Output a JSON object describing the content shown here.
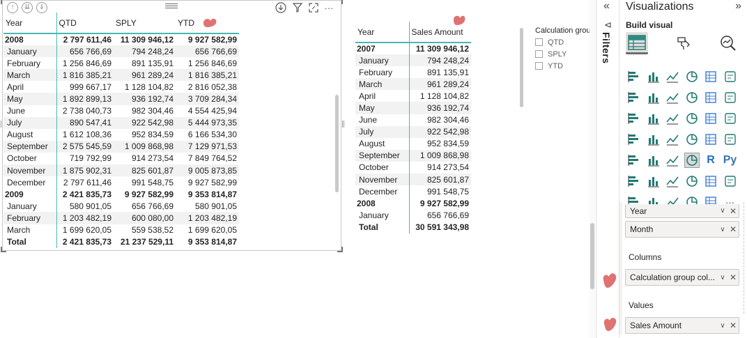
{
  "visual1": {
    "headers": [
      "Year",
      "QTD",
      "SPLY",
      "YTD"
    ],
    "rows": [
      {
        "kind": "year",
        "label": "2008",
        "qtd": "2 797 611,46",
        "sply": "11 309 946,12",
        "ytd": "9 927 582,99"
      },
      {
        "kind": "month",
        "label": "January",
        "qtd": "656 766,69",
        "sply": "794 248,24",
        "ytd": "656 766,69"
      },
      {
        "kind": "month",
        "label": "February",
        "qtd": "1 256 846,69",
        "sply": "891 135,91",
        "ytd": "1 256 846,69"
      },
      {
        "kind": "month",
        "label": "March",
        "qtd": "1 816 385,21",
        "sply": "961 289,24",
        "ytd": "1 816 385,21"
      },
      {
        "kind": "month",
        "label": "April",
        "qtd": "999 667,17",
        "sply": "1 128 104,82",
        "ytd": "2 816 052,38"
      },
      {
        "kind": "month",
        "label": "May",
        "qtd": "1 892 899,13",
        "sply": "936 192,74",
        "ytd": "3 709 284,34"
      },
      {
        "kind": "month",
        "label": "June",
        "qtd": "2 738 040,73",
        "sply": "982 304,46",
        "ytd": "4 554 425,94"
      },
      {
        "kind": "month",
        "label": "July",
        "qtd": "890 547,41",
        "sply": "922 542,98",
        "ytd": "5 444 973,35"
      },
      {
        "kind": "month",
        "label": "August",
        "qtd": "1 612 108,36",
        "sply": "952 834,59",
        "ytd": "6 166 534,30"
      },
      {
        "kind": "month",
        "label": "September",
        "qtd": "2 575 545,59",
        "sply": "1 009 868,98",
        "ytd": "7 129 971,53"
      },
      {
        "kind": "month",
        "label": "October",
        "qtd": "719 792,99",
        "sply": "914 273,54",
        "ytd": "7 849 764,52"
      },
      {
        "kind": "month",
        "label": "November",
        "qtd": "1 875 902,31",
        "sply": "825 601,87",
        "ytd": "9 005 873,85"
      },
      {
        "kind": "month",
        "label": "December",
        "qtd": "2 797 611,46",
        "sply": "991 548,75",
        "ytd": "9 927 582,99"
      },
      {
        "kind": "year",
        "label": "2009",
        "qtd": "2 421 835,73",
        "sply": "9 927 582,99",
        "ytd": "9 353 814,87"
      },
      {
        "kind": "month",
        "label": "January",
        "qtd": "580 901,05",
        "sply": "656 766,69",
        "ytd": "580 901,05"
      },
      {
        "kind": "month",
        "label": "February",
        "qtd": "1 203 482,19",
        "sply": "600 080,00",
        "ytd": "1 203 482,19"
      },
      {
        "kind": "month",
        "label": "March",
        "qtd": "1 699 620,05",
        "sply": "559 538,52",
        "ytd": "1 699 620,05"
      },
      {
        "kind": "total",
        "label": "Total",
        "qtd": "2 421 835,73",
        "sply": "21 237 529,11",
        "ytd": "9 353 814,87"
      }
    ]
  },
  "visual2": {
    "headers": [
      "Year",
      "Sales Amount"
    ],
    "rows": [
      {
        "kind": "year",
        "label": "2007",
        "value": "11 309 946,12"
      },
      {
        "kind": "month",
        "label": "January",
        "value": "794 248,24"
      },
      {
        "kind": "month",
        "label": "February",
        "value": "891 135,91"
      },
      {
        "kind": "month",
        "label": "March",
        "value": "961 289,24"
      },
      {
        "kind": "month",
        "label": "April",
        "value": "1 128 104,82"
      },
      {
        "kind": "month",
        "label": "May",
        "value": "936 192,74"
      },
      {
        "kind": "month",
        "label": "June",
        "value": "982 304,46"
      },
      {
        "kind": "month",
        "label": "July",
        "value": "922 542,98"
      },
      {
        "kind": "month",
        "label": "August",
        "value": "952 834,59"
      },
      {
        "kind": "month",
        "label": "September",
        "value": "1 009 868,98"
      },
      {
        "kind": "month",
        "label": "October",
        "value": "914 273,54"
      },
      {
        "kind": "month",
        "label": "November",
        "value": "825 601,87"
      },
      {
        "kind": "month",
        "label": "December",
        "value": "991 548,75"
      },
      {
        "kind": "year",
        "label": "2008",
        "value": "9 927 582,99"
      },
      {
        "kind": "month",
        "label": "January",
        "value": "656 766,69"
      },
      {
        "kind": "total",
        "label": "Total",
        "value": "30 591 343,98"
      }
    ]
  },
  "slicer": {
    "title": "Calculation grou",
    "options": [
      "QTD",
      "SPLY",
      "YTD"
    ]
  },
  "filters_pane": {
    "label": "Filters",
    "collapse_glyph": "«",
    "filter_glyph": "⊲"
  },
  "visualizations_pane": {
    "title": "Visualizations",
    "expand_glyph": "»",
    "build_label": "Build visual",
    "more_glyph": "···",
    "r_glyph": "R",
    "py_glyph": "Py",
    "rows_fields": [
      "Year",
      "Month"
    ],
    "columns_label": "Columns",
    "columns_field": "Calculation group col...",
    "values_label": "Values",
    "values_field": "Sales Amount"
  },
  "colors": {
    "accent": "#48b7b3",
    "heart": "#e07272",
    "band": "#f2f2f2"
  }
}
